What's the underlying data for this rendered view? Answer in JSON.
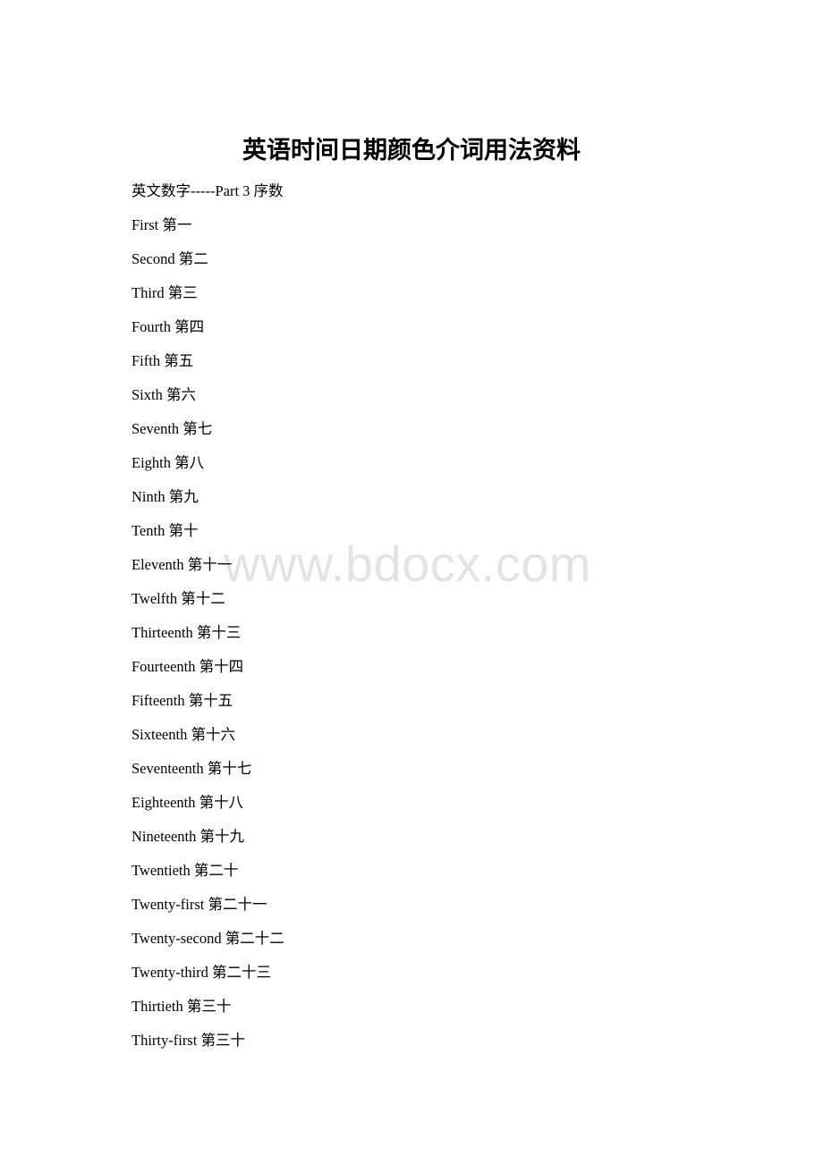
{
  "document": {
    "title": "英语时间日期颜色介词用法资料",
    "subtitle": "英文数字-----Part 3 序数",
    "ordinals": [
      {
        "english": "First",
        "chinese": "第一"
      },
      {
        "english": "Second",
        "chinese": "第二"
      },
      {
        "english": "Third",
        "chinese": "第三"
      },
      {
        "english": "Fourth",
        "chinese": "第四"
      },
      {
        "english": "Fifth",
        "chinese": "第五"
      },
      {
        "english": "Sixth",
        "chinese": "第六"
      },
      {
        "english": "Seventh",
        "chinese": "第七"
      },
      {
        "english": "Eighth",
        "chinese": "第八"
      },
      {
        "english": "Ninth",
        "chinese": "第九"
      },
      {
        "english": "Tenth",
        "chinese": "第十"
      },
      {
        "english": "Eleventh",
        "chinese": "第十一"
      },
      {
        "english": "Twelfth",
        "chinese": "第十二"
      },
      {
        "english": "Thirteenth",
        "chinese": "第十三"
      },
      {
        "english": "Fourteenth",
        "chinese": "第十四"
      },
      {
        "english": "Fifteenth",
        "chinese": "第十五"
      },
      {
        "english": "Sixteenth",
        "chinese": "第十六"
      },
      {
        "english": "Seventeenth",
        "chinese": "第十七"
      },
      {
        "english": "Eighteenth",
        "chinese": "第十八"
      },
      {
        "english": "Nineteenth",
        "chinese": "第十九"
      },
      {
        "english": "Twentieth",
        "chinese": "第二十"
      },
      {
        "english": "Twenty-first",
        "chinese": "第二十一"
      },
      {
        "english": "Twenty-second",
        "chinese": "第二十二"
      },
      {
        "english": "Twenty-third",
        "chinese": "第二十三"
      },
      {
        "english": "Thirtieth",
        "chinese": "第三十"
      },
      {
        "english": "Thirty-first",
        "chinese": "第三十"
      }
    ]
  },
  "watermark": "www.bdocx.com"
}
